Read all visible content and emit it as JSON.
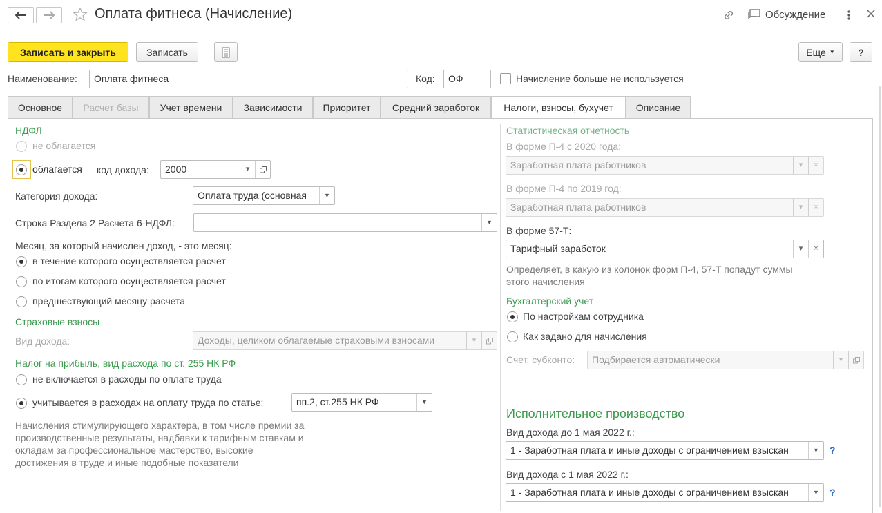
{
  "window": {
    "title": "Оплата фитнеса (Начисление)",
    "discussion_label": "Обсуждение"
  },
  "toolbar": {
    "save_close_label": "Записать и закрыть",
    "save_label": "Записать",
    "more_label": "Еще",
    "help_label": "?"
  },
  "header": {
    "name_label": "Наименование:",
    "name_value": "Оплата фитнеса",
    "code_label": "Код:",
    "code_value": "ОФ",
    "unused_label": "Начисление больше не используется"
  },
  "tabs": [
    {
      "label": "Основное"
    },
    {
      "label": "Расчет базы"
    },
    {
      "label": "Учет времени"
    },
    {
      "label": "Зависимости"
    },
    {
      "label": "Приоритет"
    },
    {
      "label": "Средний заработок"
    },
    {
      "label": "Налоги, взносы, бухучет"
    },
    {
      "label": "Описание"
    }
  ],
  "ndfl": {
    "heading": "НДФЛ",
    "not_taxed_label": "не облагается",
    "taxed_label": "облагается",
    "income_code_label": "код дохода:",
    "income_code_value": "2000",
    "income_category_label": "Категория дохода:",
    "income_category_value": "Оплата труда (основная",
    "section2_label": "Строка Раздела 2 Расчета 6-НДФЛ:",
    "section2_value": "",
    "month_question": "Месяц, за который начислен доход, - это месяц:",
    "month_opt1": "в течение которого осуществляется расчет",
    "month_opt2": "по итогам которого осуществляется расчет",
    "month_opt3": "предшествующий месяцу расчета"
  },
  "insurance": {
    "heading": "Страховые взносы",
    "income_type_label": "Вид дохода:",
    "income_type_value": "Доходы, целиком облагаемые страховыми взносами"
  },
  "profit_tax": {
    "heading": "Налог на прибыль, вид расхода по ст. 255 НК РФ",
    "opt1": "не включается в расходы по оплате труда",
    "opt2": "учитывается в расходах на оплату труда по статье:",
    "article_value": "пп.2, ст.255 НК РФ",
    "note_lines": [
      "Начисления стимулирующего характера, в том числе премии за",
      "производственные результаты, надбавки к тарифным ставкам и",
      "окладам за профессиональное мастерство, высокие",
      "достижения в труде и иные подобные показатели"
    ]
  },
  "stats": {
    "heading": "Статистическая отчетность",
    "p4_2020_label": "В форме П-4 с 2020 года:",
    "p4_2020_value": "Заработная плата работников",
    "p4_2019_label": "В форме П-4 по 2019 год:",
    "p4_2019_value": "Заработная плата работников",
    "f57t_label": "В форме 57-Т:",
    "f57t_value": "Тарифный заработок",
    "note_lines": [
      "Определяет, в какую из колонок форм П-4, 57-Т попадут суммы",
      "этого начисления"
    ]
  },
  "accounting": {
    "heading": "Бухгалтерский учет",
    "opt1": "По настройкам сотрудника",
    "opt2": "Как задано для начисления",
    "account_label": "Счет, субконто:",
    "account_value": "Подбирается автоматически"
  },
  "enforcement": {
    "heading": "Исполнительное производство",
    "before_label": "Вид дохода до 1 мая 2022 г.:",
    "before_value": "1 - Заработная плата и иные доходы с ограничением взыскан",
    "after_label": "Вид дохода с 1 мая 2022 г.:",
    "after_value": "1 - Заработная плата и иные доходы с ограничением взыскан",
    "help_mark": "?"
  },
  "icons": {
    "back": "arrow-left-icon",
    "forward": "arrow-right-icon",
    "favorite": "star-icon",
    "link": "link-icon",
    "discussion": "chat-icon",
    "menu": "kebab-menu-icon",
    "close": "close-icon",
    "report": "report-icon"
  }
}
